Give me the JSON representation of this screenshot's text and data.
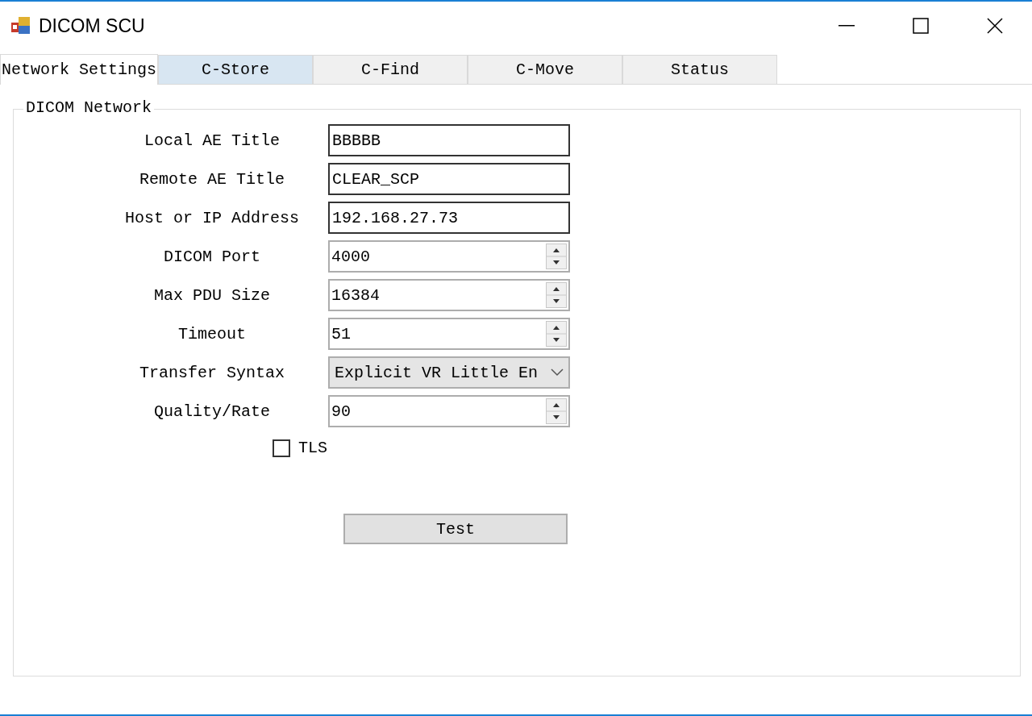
{
  "window": {
    "title": "DICOM SCU"
  },
  "tabs": [
    {
      "label": "Network Settings",
      "selected": true,
      "highlighted": false
    },
    {
      "label": "C-Store",
      "selected": false,
      "highlighted": true
    },
    {
      "label": "C-Find",
      "selected": false,
      "highlighted": false
    },
    {
      "label": "C-Move",
      "selected": false,
      "highlighted": false
    },
    {
      "label": "Status",
      "selected": false,
      "highlighted": false
    }
  ],
  "group": {
    "title": "DICOM Network"
  },
  "fields": [
    {
      "label": "Local AE Title",
      "kind": "text",
      "value": "BBBBB"
    },
    {
      "label": "Remote AE Title",
      "kind": "text",
      "value": "CLEAR_SCP"
    },
    {
      "label": "Host or IP Address",
      "kind": "text",
      "value": "192.168.27.73"
    },
    {
      "label": "DICOM Port",
      "kind": "spin",
      "value": "4000"
    },
    {
      "label": "Max PDU Size",
      "kind": "spin",
      "value": "16384"
    },
    {
      "label": "Timeout",
      "kind": "spin",
      "value": "51"
    },
    {
      "label": "Transfer Syntax",
      "kind": "combo",
      "value": "Explicit VR Little En"
    },
    {
      "label": "Quality/Rate",
      "kind": "spin",
      "value": "90"
    }
  ],
  "tls": {
    "label": "TLS",
    "checked": false
  },
  "test_button": {
    "label": "Test"
  }
}
